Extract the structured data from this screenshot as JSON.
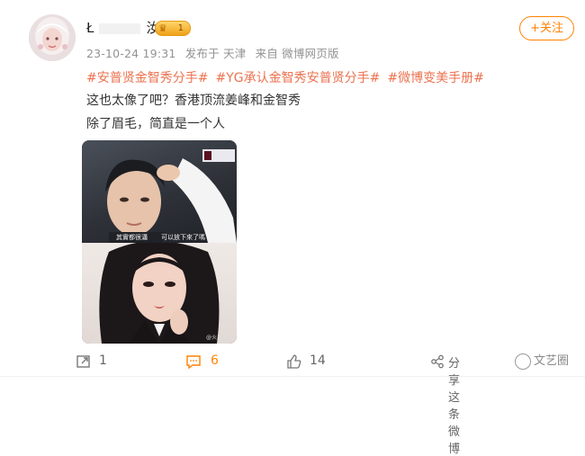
{
  "user": {
    "name_visible_prefix": "Ł",
    "name_visible_suffix": "汝",
    "vip_level": "1"
  },
  "meta": {
    "time": "23-10-24 19:31",
    "location": "发布于 天津",
    "source": "来自 微博网页版"
  },
  "follow_label": "+关注",
  "tags": [
    "#安普贤金智秀分手#",
    "#YG承认金智秀安普贤分手#",
    "#微博变美手册#"
  ],
  "text_lines": [
    "这也太像了吧？香港顶流姜峰和金智秀",
    "除了眉毛，简直是一个人"
  ],
  "image": {
    "subtitle_left": "其實都很瀟",
    "subtitle_right": "可以放下來了嗎",
    "watermark": "@火星男孩"
  },
  "actions": {
    "repost_count": "1",
    "comment_count": "6",
    "like_count": "14",
    "share_label": "分享这条微博"
  },
  "watermark_brand": "文艺圈",
  "colors": {
    "accent": "#ff8200",
    "tag": "#eb7350",
    "meta": "#939393"
  }
}
